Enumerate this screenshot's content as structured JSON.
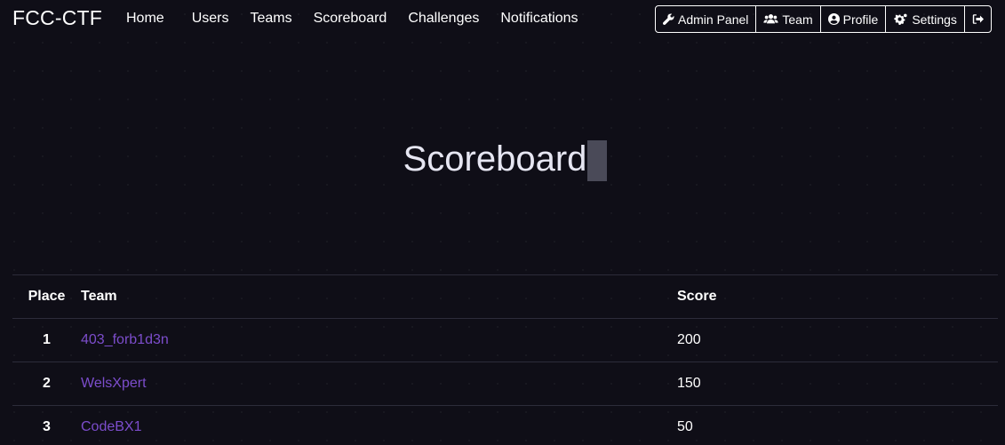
{
  "navbar": {
    "brand": "FCC-CTF",
    "links": [
      "Home",
      "Users",
      "Teams",
      "Scoreboard",
      "Challenges",
      "Notifications"
    ],
    "buttons": {
      "admin": "Admin Panel",
      "team": "Team",
      "profile": "Profile",
      "settings": "Settings"
    }
  },
  "page": {
    "title": "Scoreboard"
  },
  "table": {
    "headers": [
      "Place",
      "Team",
      "Score"
    ],
    "rows": [
      {
        "place": "1",
        "team": "403_forb1d3n",
        "score": "200"
      },
      {
        "place": "2",
        "team": "WelsXpert",
        "score": "150"
      },
      {
        "place": "3",
        "team": "CodeBX1",
        "score": "50"
      }
    ]
  },
  "colors": {
    "background": "#0f0e17",
    "link_accent": "#7c4dcc",
    "text": "#ffffff"
  },
  "icons": {
    "admin": "wrench-icon",
    "team": "users-icon",
    "profile": "user-circle-icon",
    "settings": "cogs-icon",
    "logout": "sign-out-icon"
  }
}
